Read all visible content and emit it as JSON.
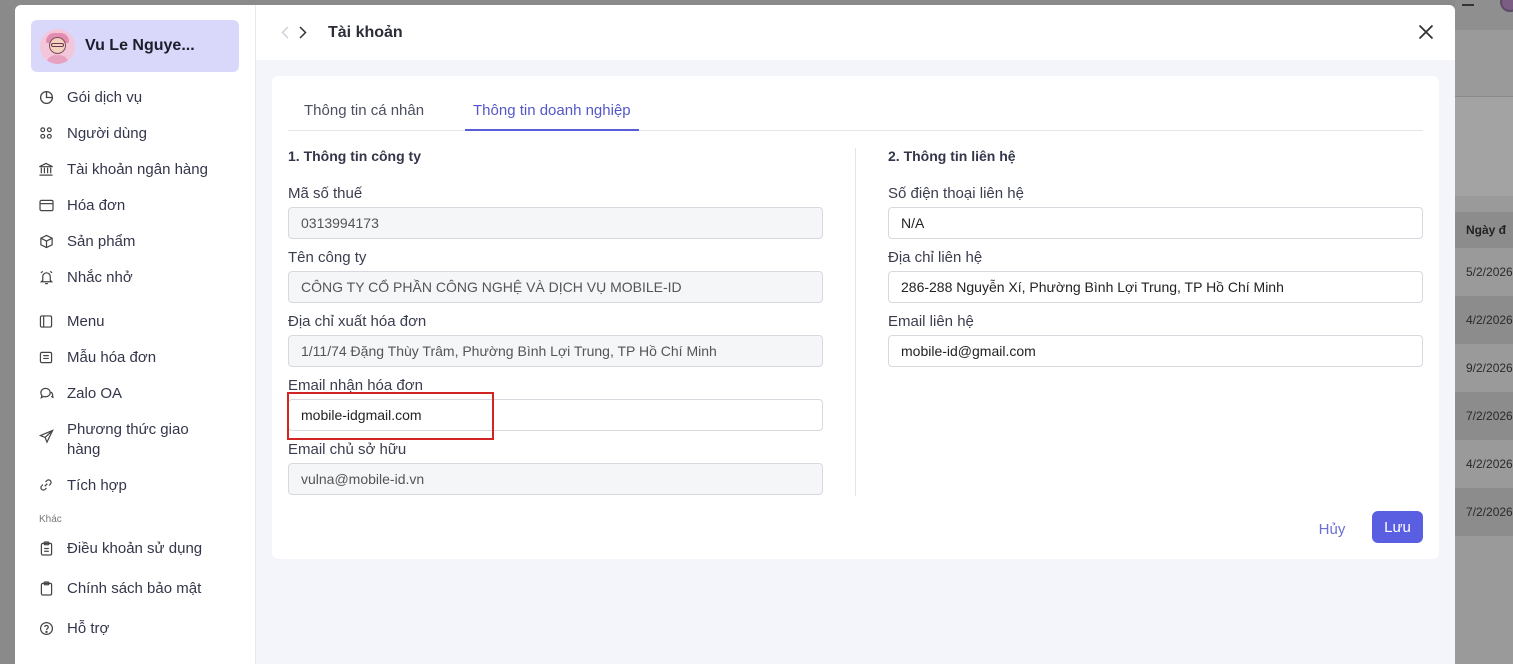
{
  "background": {
    "column_header": "Ngày đ",
    "rows": [
      "5/2/2026",
      "4/2/2026",
      "9/2/2026",
      "7/2/2026",
      "4/2/2026",
      "7/2/2026"
    ]
  },
  "user": {
    "name": "Vu Le Nguye..."
  },
  "sidebar": {
    "items": [
      {
        "label": "Gói dịch vụ",
        "icon": "pie-chart-icon"
      },
      {
        "label": "Người dùng",
        "icon": "users-icon"
      },
      {
        "label": "Tài khoản ngân hàng",
        "icon": "bank-icon"
      },
      {
        "label": "Hóa đơn",
        "icon": "invoice-card-icon"
      },
      {
        "label": "Sản phẩm",
        "icon": "box-icon"
      },
      {
        "label": "Nhắc nhở",
        "icon": "alarm-icon"
      },
      {
        "label": "Menu",
        "icon": "menu-panel-icon"
      },
      {
        "label": "Mẫu hóa đơn",
        "icon": "template-icon"
      },
      {
        "label": "Zalo OA",
        "icon": "chat-icon"
      },
      {
        "label": "Phương thức giao hàng",
        "icon": "send-icon"
      },
      {
        "label": "Tích hợp",
        "icon": "link-icon"
      }
    ],
    "section_other": "Khác",
    "other_items": [
      {
        "label": "Điều khoản sử dụng",
        "icon": "clipboard-icon"
      },
      {
        "label": "Chính sách bảo mật",
        "icon": "clipboard-icon"
      },
      {
        "label": "Hỗ trợ",
        "icon": "help-icon"
      }
    ]
  },
  "header": {
    "title": "Tài khoản"
  },
  "tabs": [
    {
      "label": "Thông tin cá nhân",
      "active": false
    },
    {
      "label": "Thông tin doanh nghiệp",
      "active": true
    }
  ],
  "company": {
    "section_title": "1. Thông tin công ty",
    "tax_code_label": "Mã số thuế",
    "tax_code": "0313994173",
    "company_name_label": "Tên công ty",
    "company_name": "CÔNG TY CỔ PHẦN CÔNG NGHỆ VÀ DỊCH VỤ MOBILE-ID",
    "invoice_address_label": "Địa chỉ xuất hóa đơn",
    "invoice_address": "1/11/74 Đặng Thùy Trâm, Phường Bình Lợi Trung, TP Hồ Chí Minh",
    "invoice_email_label": "Email nhận hóa đơn",
    "invoice_email": "mobile-idgmail.com",
    "owner_email_label": "Email chủ sở hữu",
    "owner_email": "vulna@mobile-id.vn"
  },
  "contact": {
    "section_title": "2. Thông tin liên hệ",
    "phone_label": "Số điện thoại liên hệ",
    "phone": "N/A",
    "address_label": "Địa chỉ liên hệ",
    "address": "286-288 Nguyễn Xí, Phường Bình Lợi Trung, TP Hồ Chí Minh",
    "email_label": "Email liên hệ",
    "email": "mobile-id@gmail.com"
  },
  "actions": {
    "cancel": "Hủy",
    "save": "Lưu"
  },
  "colors": {
    "accent": "#5a5ee0",
    "highlight": "#d32424",
    "user_card": "#d9d8fb"
  }
}
